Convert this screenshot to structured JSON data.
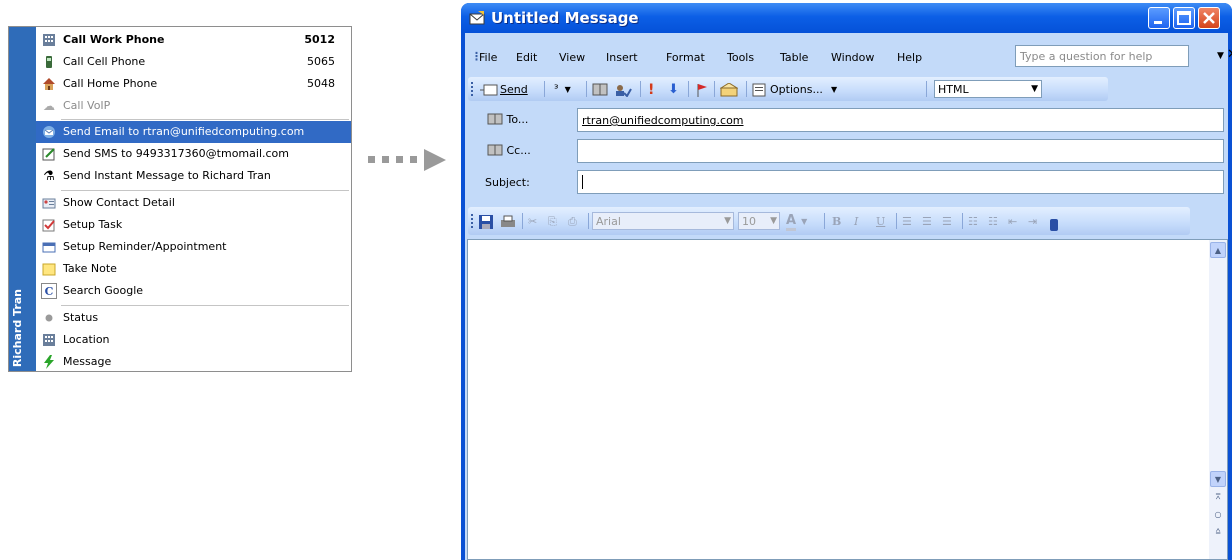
{
  "context_menu": {
    "contact_name": "Richard Tran",
    "items": [
      {
        "label": "Call Work Phone",
        "number": "5012",
        "icon": "work-phone-icon",
        "bold": true
      },
      {
        "label": "Call Cell Phone",
        "number": "5065",
        "icon": "cell-phone-icon"
      },
      {
        "label": "Call Home Phone",
        "number": "5048",
        "icon": "home-icon"
      },
      {
        "label": "Call VoIP",
        "icon": "voip-icon",
        "disabled": true
      },
      {
        "label": "Send Email to rtran@unifiedcomputing.com",
        "icon": "email-icon",
        "selected": true
      },
      {
        "label": "Send SMS to 9493317360@tmomail.com",
        "icon": "sms-icon"
      },
      {
        "label": "Send Instant Message to Richard Tran",
        "icon": "instant-message-icon"
      },
      {
        "label": "Show Contact Detail",
        "icon": "contact-card-icon"
      },
      {
        "label": "Setup Task",
        "icon": "task-icon"
      },
      {
        "label": "Setup Reminder/Appointment",
        "icon": "calendar-icon"
      },
      {
        "label": "Take Note",
        "icon": "note-icon"
      },
      {
        "label": "Search Google",
        "icon": "google-icon"
      },
      {
        "label": "Status",
        "icon": "status-dot-icon"
      },
      {
        "label": "Location",
        "icon": "location-icon"
      },
      {
        "label": "Message",
        "icon": "lightning-icon"
      }
    ]
  },
  "window": {
    "title": "Untitled Message",
    "menus": [
      "File",
      "Edit",
      "View",
      "Insert",
      "Format",
      "Tools",
      "Table",
      "Window",
      "Help"
    ],
    "help_placeholder": "Type a question for help",
    "toolbar": {
      "send_label": "Send",
      "options_label": "Options...",
      "format_value": "HTML"
    },
    "fields": {
      "to_label": "To...",
      "to_value": "rtran@unifiedcomputing.com",
      "cc_label": "Cc...",
      "cc_value": "",
      "subject_label": "Subject:",
      "subject_value": ""
    },
    "format_toolbar": {
      "font": "Arial",
      "size": "10"
    }
  },
  "colors": {
    "menu_band": "#2f6cb9",
    "selection": "#316ac5",
    "title_bar": "#0c5fe6",
    "client_bg": "#c3daf9"
  }
}
